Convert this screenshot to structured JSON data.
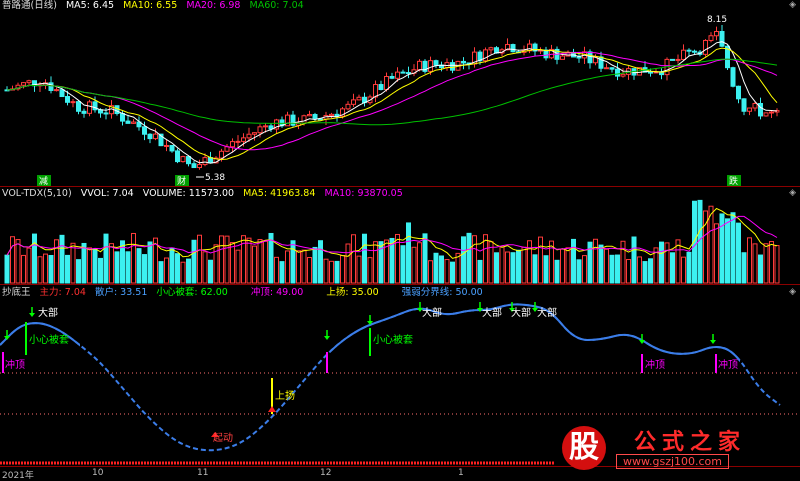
{
  "header": {
    "title": "普路通(日线)",
    "ma5": "MA5: 6.45",
    "ma10": "MA10: 6.55",
    "ma20": "MA20: 6.98",
    "ma60": "MA60: 7.04"
  },
  "vol_header": {
    "name": "VOL-TDX(5,10)",
    "vvol": "VVOL: 7.04",
    "volume": "VOLUME: 11573.00",
    "ma5": "MA5: 41963.84",
    "ma10": "MA10: 93870.05"
  },
  "ind_header": {
    "name": "抄底王",
    "zhuli": "主力: 7.04",
    "sanhu": "散户: 33.51",
    "xiaoxin": "小心被套: 62.00",
    "chongding": "冲顶: 49.00",
    "shangyang": "上扬: 35.00",
    "qiangruo": "强弱分界线: 50.00"
  },
  "colors": {
    "up": "#ff3b3b",
    "down": "#3cf0f0",
    "ma5": "#ffffff",
    "ma10": "#ffff00",
    "ma20": "#ff00ff",
    "ma60": "#00c000",
    "line": "#3b7de8",
    "green_label": "#00ff00",
    "magenta": "#ff00ff"
  },
  "price_labels": {
    "high": "8.15",
    "low": "5.38"
  },
  "signal_boxes": [
    {
      "label": "减"
    },
    {
      "label": "财"
    },
    {
      "label": "跌"
    }
  ],
  "indicator_labels": {
    "dabu": "大部",
    "xiaoxin": "小心被套",
    "chongding": "冲顶",
    "qidong": "起动",
    "shangyang": "上扬"
  },
  "x_axis": [
    "2021年",
    "10",
    "11",
    "12",
    "1"
  ],
  "watermark": {
    "char": "股",
    "title": "公式之家",
    "url": "www.gszj100.com"
  },
  "chart_data": {
    "type": "candlestick",
    "series": [
      {
        "name": "MA5",
        "last": 6.45
      },
      {
        "name": "MA10",
        "last": 6.55
      },
      {
        "name": "MA20",
        "last": 6.98
      },
      {
        "name": "MA60",
        "last": 7.04
      }
    ],
    "annotations": [
      "8.15",
      "5.38"
    ],
    "indicator": {
      "name": "抄底王",
      "values": {
        "主力": 7.04,
        "散户": 33.51,
        "小心被套": 62.0,
        "冲顶": 49.0,
        "上扬": 35.0,
        "强弱分界线": 50.0
      }
    },
    "volume": {
      "name": "VOL-TDX(5,10)",
      "VVOL": 7.04,
      "VOLUME": 11573.0,
      "MA5": 41963.84,
      "MA10": 93870.05
    }
  }
}
